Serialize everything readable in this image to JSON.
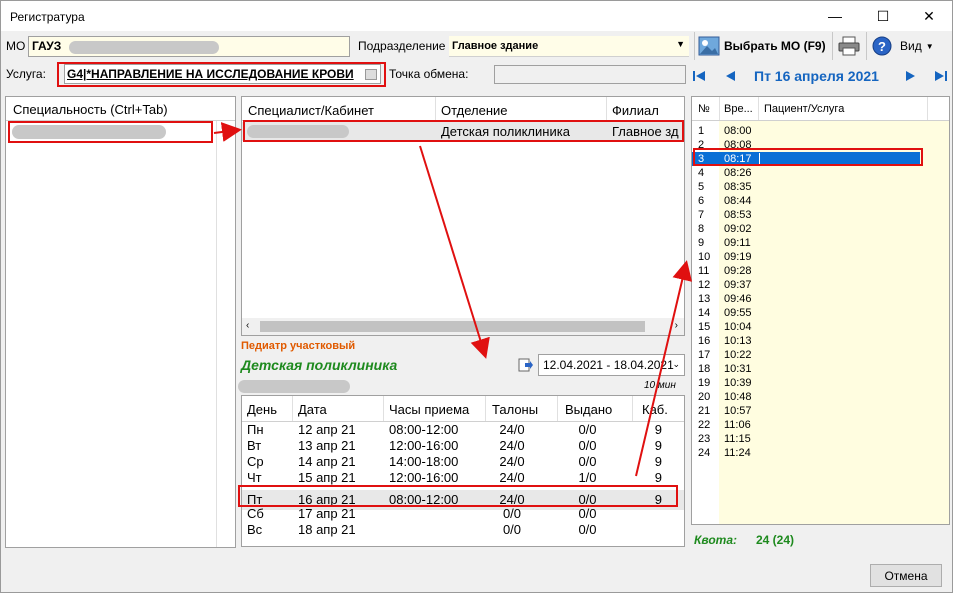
{
  "window": {
    "title": "Регистратура",
    "minimize": "—",
    "maximize": "☐",
    "close": "✕"
  },
  "toolbar": {
    "mo_label": "МО",
    "mo_value": "ГАУЗ",
    "subdivision_label": "Подразделение",
    "subdivision_value": "Главное здание",
    "choose_mo": "Выбрать МО (F9)",
    "view": "Вид"
  },
  "service": {
    "label": "Услуга:",
    "value": "G4|*НАПРАВЛЕНИЕ НА ИССЛЕДОВАНИЕ КРОВИ",
    "exchange_label": "Точка обмена:"
  },
  "calendar": {
    "date": "Пт 16 апреля 2021"
  },
  "specialty": {
    "header": "Специальность (Ctrl+Tab)"
  },
  "specialists": {
    "headers": [
      "Специалист/Кабинет",
      "Отделение",
      "Филиал"
    ],
    "row": {
      "department": "Детская поликлиника",
      "branch": "Главное зд"
    }
  },
  "doctor": {
    "position": "Педиатр участковый",
    "department": "Детская поликлиника",
    "range": "12.04.2021 - 18.04.2021",
    "duration": "10 мин"
  },
  "schedule": {
    "headers": [
      "День",
      "Дата",
      "Часы приема",
      "Талоны",
      "Выдано",
      "Каб."
    ],
    "rows": [
      [
        "Пн",
        "12 апр 21",
        "08:00-12:00",
        "24/0",
        "0/0",
        "9"
      ],
      [
        "Вт",
        "13 апр 21",
        "12:00-16:00",
        "24/0",
        "0/0",
        "9"
      ],
      [
        "Ср",
        "14 апр 21",
        "14:00-18:00",
        "24/0",
        "0/0",
        "9"
      ],
      [
        "Чт",
        "15 апр 21",
        "12:00-16:00",
        "24/0",
        "1/0",
        "9"
      ],
      [
        "Пт",
        "16 апр 21",
        "08:00-12:00",
        "24/0",
        "0/0",
        "9"
      ],
      [
        "Сб",
        "17 апр 21",
        "",
        "0/0",
        "0/0",
        ""
      ],
      [
        "Вс",
        "18 апр 21",
        "",
        "0/0",
        "0/0",
        ""
      ]
    ]
  },
  "slots": {
    "headers": [
      "№",
      "Вре...",
      "Пациент/Услуга"
    ],
    "rows": [
      [
        "1",
        "08:00"
      ],
      [
        "2",
        "08:08"
      ],
      [
        "3",
        "08:17"
      ],
      [
        "4",
        "08:26"
      ],
      [
        "5",
        "08:35"
      ],
      [
        "6",
        "08:44"
      ],
      [
        "7",
        "08:53"
      ],
      [
        "8",
        "09:02"
      ],
      [
        "9",
        "09:11"
      ],
      [
        "10",
        "09:19"
      ],
      [
        "11",
        "09:28"
      ],
      [
        "12",
        "09:37"
      ],
      [
        "13",
        "09:46"
      ],
      [
        "14",
        "09:55"
      ],
      [
        "15",
        "10:04"
      ],
      [
        "16",
        "10:13"
      ],
      [
        "17",
        "10:22"
      ],
      [
        "18",
        "10:31"
      ],
      [
        "19",
        "10:39"
      ],
      [
        "20",
        "10:48"
      ],
      [
        "21",
        "10:57"
      ],
      [
        "22",
        "11:06"
      ],
      [
        "23",
        "11:15"
      ],
      [
        "24",
        "11:24"
      ]
    ]
  },
  "quota": {
    "label": "Квота:",
    "value": "24 (24)"
  },
  "footer": {
    "cancel": "Отмена"
  },
  "colors": {
    "accent_red": "#e01010",
    "select_blue": "#0a6fd6",
    "green": "#1e8a1e",
    "orange": "#e05a00",
    "nav_blue": "#1565c0"
  }
}
